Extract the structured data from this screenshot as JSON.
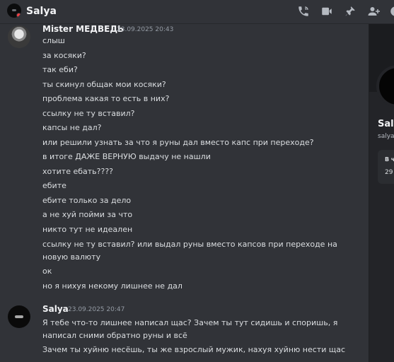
{
  "header": {
    "title": "Salya",
    "icons": [
      "call-icon",
      "video-icon",
      "pin-icon",
      "add-friend-icon",
      "profile-icon"
    ]
  },
  "messages": [
    {
      "author": "Mister МЕДВЕДЬ",
      "timestamp": "23.09.2025 20:43",
      "lines": [
        "слыш",
        "за косяки?",
        "так еби?",
        "ты скинул общак мои косяки?",
        "проблема какая то есть в них?",
        "ссылку не ту вставил?",
        "капсы не дал?",
        "или решили узнать за что я руны дал вместо капс при переходе?",
        "в итоге ДАЖЕ ВЕРНУЮ выдачу не нашли",
        "хотите ебать????",
        "ебите",
        "ебите только за дело",
        "а не хуй пойми за что",
        "никто тут не идеален",
        "ссылку не ту вставил? или выдал руны вместо капсов при переходе на",
        "новую валюту",
        "ок",
        "но я нихуя некому лишнее не дал"
      ]
    },
    {
      "author": "Salya",
      "timestamp": "23.09.2025 20:47",
      "lines": [
        "Я тебе что-то лишнее написал щас? Зачем ты тут сидишь и споришь, я",
        "написал сними обратно руны и всё",
        "Зачем ты хуйню несёшь, ты же взрослый мужик, нахуя хуйню нести щас"
      ]
    }
  ],
  "profile": {
    "name": "Salya",
    "username": "salya",
    "card_label": "В ч",
    "card_value": "29"
  }
}
